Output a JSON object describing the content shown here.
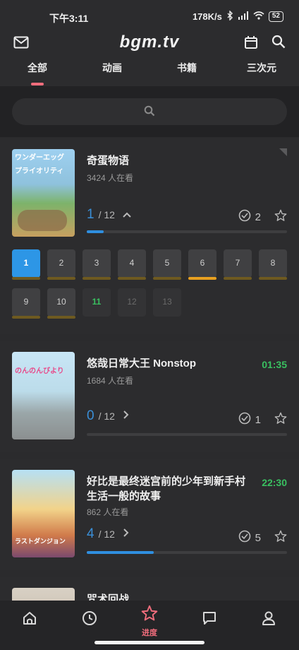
{
  "status_bar": {
    "time": "下午3:11",
    "speed": "178K/s",
    "battery": "52"
  },
  "app": {
    "logo": "bgm.tv",
    "tabs": [
      "全部",
      "动画",
      "书籍",
      "三次元"
    ],
    "active_tab": "全部"
  },
  "subjects": [
    {
      "title": "奇蛋物语",
      "watching": "3424 人在看",
      "airtime": "",
      "progress_current": "1",
      "progress_total": "/ 12",
      "done": "2",
      "progress_fraction": 0.083,
      "cover_text": [
        "ワンダーエッグ",
        "プライオリティ"
      ],
      "episodes": [
        {
          "n": "1",
          "state": "current"
        },
        {
          "n": "2",
          "state": "aired"
        },
        {
          "n": "3",
          "state": "aired"
        },
        {
          "n": "4",
          "state": "aired"
        },
        {
          "n": "5",
          "state": "aired"
        },
        {
          "n": "6",
          "state": "hot"
        },
        {
          "n": "7",
          "state": "aired"
        },
        {
          "n": "8",
          "state": "aired"
        },
        {
          "n": "9",
          "state": "aired"
        },
        {
          "n": "10",
          "state": "aired"
        },
        {
          "n": "11",
          "state": "new"
        },
        {
          "n": "12",
          "state": "future"
        },
        {
          "n": "13",
          "state": "future"
        }
      ]
    },
    {
      "title": "悠哉日常大王 Nonstop",
      "watching": "1684 人在看",
      "airtime": "01:35",
      "progress_current": "0",
      "progress_total": "/ 12",
      "done": "1",
      "progress_fraction": 0.0,
      "cover_text": [
        "のんのんびより"
      ]
    },
    {
      "title_lines": [
        "好比是最终迷宫前的少年到新手村",
        "生活一般的故事"
      ],
      "watching": "862 人在看",
      "airtime": "22:30",
      "progress_current": "4",
      "progress_total": "/ 12",
      "done": "5",
      "progress_fraction": 0.333,
      "cover_text": [
        "ラストダンジョン"
      ]
    },
    {
      "title": "咒术回战"
    }
  ],
  "bottom_nav": {
    "active_label": "进度"
  },
  "colors": {
    "accent": "#f06d7c",
    "progress": "#2f8fe0",
    "airtime": "#39c060"
  }
}
